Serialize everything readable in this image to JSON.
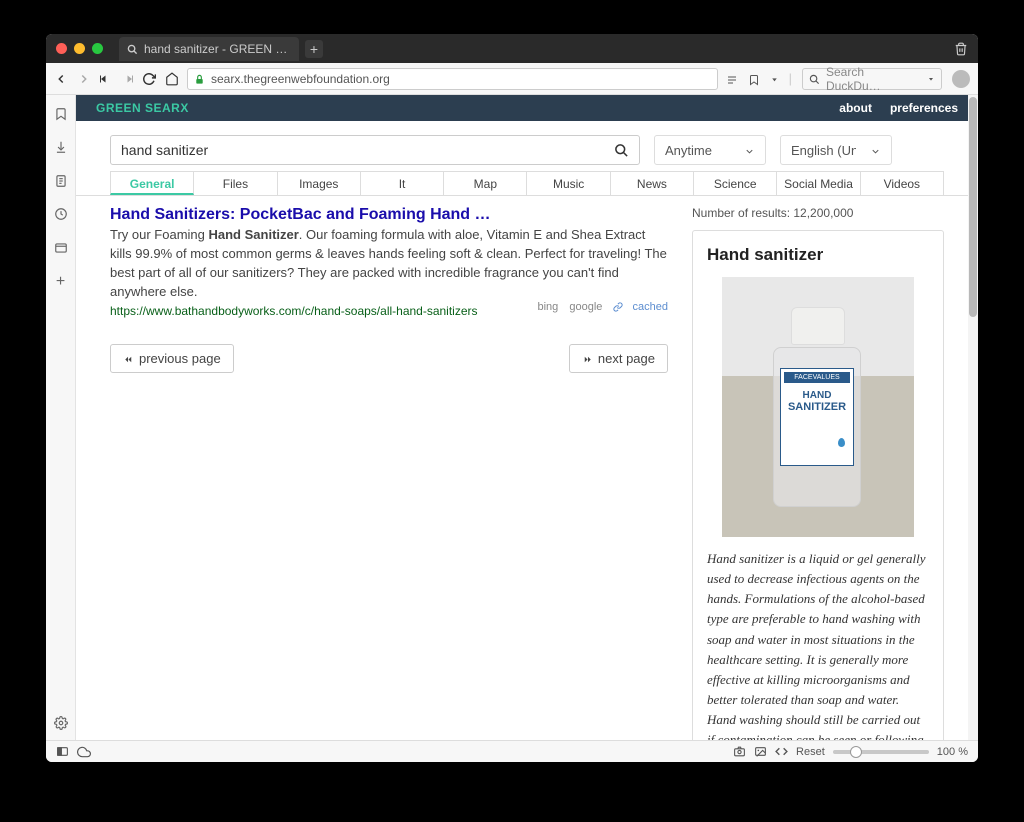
{
  "window": {
    "tab_title": "hand sanitizer - GREEN SEA",
    "url": "searx.thegreenwebfoundation.org",
    "search_placeholder": "Search DuckDu…"
  },
  "searx": {
    "brand": "GREEN SEARX",
    "nav": {
      "about": "about",
      "preferences": "preferences"
    },
    "query": "hand sanitizer",
    "time_filter": "Anytime",
    "language": "English (United Sta",
    "tabs": [
      "General",
      "Files",
      "Images",
      "It",
      "Map",
      "Music",
      "News",
      "Science",
      "Social Media",
      "Videos"
    ],
    "active_tab": 0
  },
  "result": {
    "title_prefix": "Hand Sanitizers",
    "title_suffix": ": PocketBac and Foaming Hand …",
    "snippet_pre": "Try our Foaming ",
    "snippet_bold": "Hand Sanitizer",
    "snippet_post": ". Our foaming formula with aloe, Vitamin E and Shea Extract kills 99.9% of most common germs & leaves hands feeling soft & clean. Perfect for traveling! The best part of all of our sanitizers? They are packed with incredible fragrance you can't find anywhere else.",
    "url": "https://www.bathandbodyworks.com/c/hand-soaps/all-hand-sanitizers",
    "sources": {
      "bing": "bing",
      "google": "google",
      "cached": "cached"
    }
  },
  "pager": {
    "prev": "previous page",
    "next": "next page"
  },
  "sidebar": {
    "numresults_label": "Number of results: ",
    "numresults_value": "12,200,000",
    "infobox": {
      "title": "Hand sanitizer",
      "image_label_brand": "FACEVALUES",
      "image_label_line1": "HAND",
      "image_label_line2": "SANITIZER",
      "desc": "Hand sanitizer is a liquid or gel generally used to decrease infectious agents on the hands. Formulations of the alcohol-based type are preferable to hand washing with soap and water in most situations in the healthcare setting. It is generally more effective at killing microorganisms and better tolerated than soap and water. Hand washing should still be carried out if contamination can be seen or following the use of the toilet. The general use of"
    }
  },
  "statusbar": {
    "reset": "Reset",
    "zoom": "100 %"
  }
}
